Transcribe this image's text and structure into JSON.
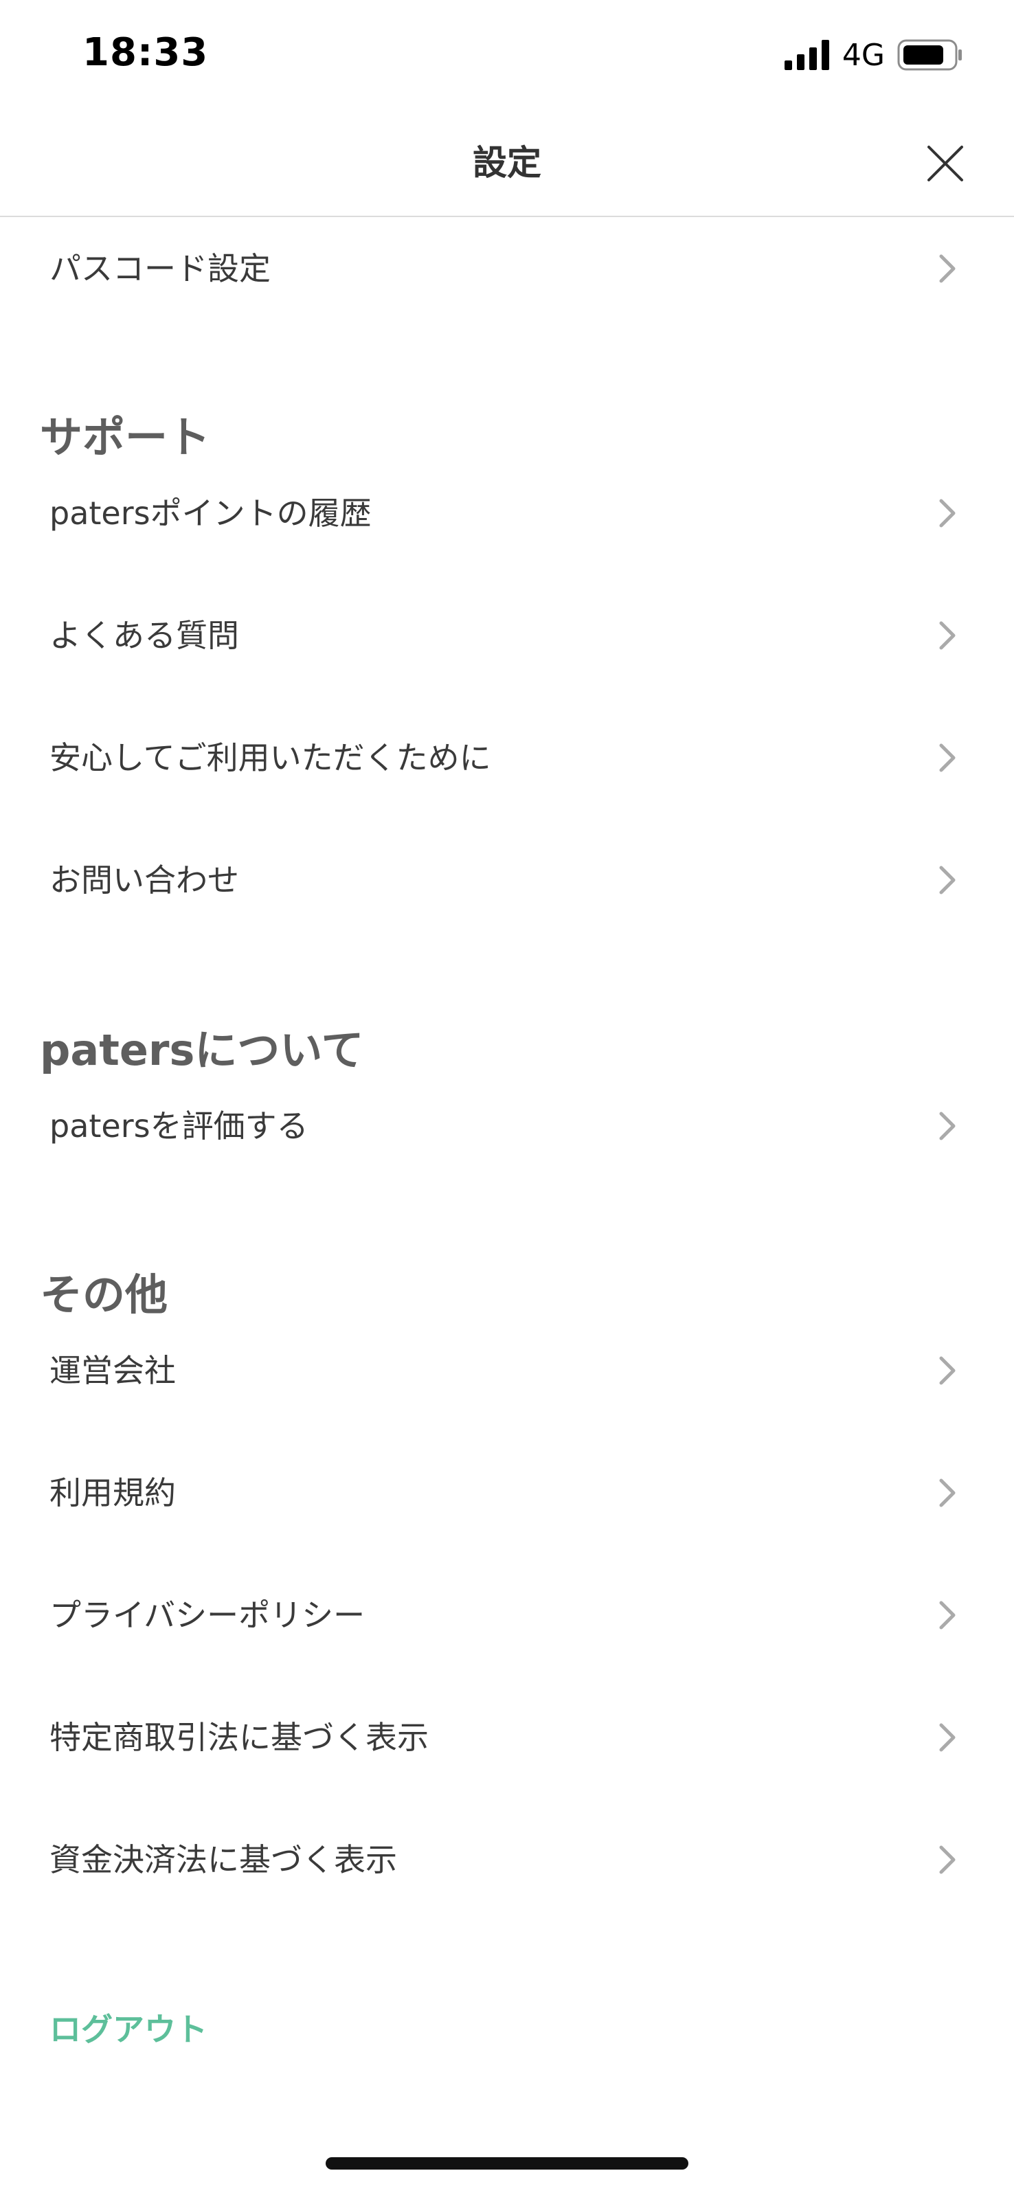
{
  "status_bar": {
    "time": "18:33",
    "network": "4G"
  },
  "header": {
    "title": "設定"
  },
  "rows": [
    "パスコード設定",
    "patersポイントの履歴",
    "よくある質問",
    "安心してご利用いただくために",
    "お問い合わせ",
    "patersを評価する",
    "運営会社",
    "利用規約",
    "プライバシーポリシー",
    "特定商取引法に基づく表示",
    "資金決済法に基づく表示"
  ],
  "sections": {
    "support": "サポート",
    "about": "patersについて",
    "other": "その他"
  },
  "logout_label": "ログアウト",
  "colors": {
    "accent": "#5dbf9a",
    "text": "#3a3a3a",
    "section_title": "#5e5e5e",
    "divider": "#dcdcdc"
  }
}
